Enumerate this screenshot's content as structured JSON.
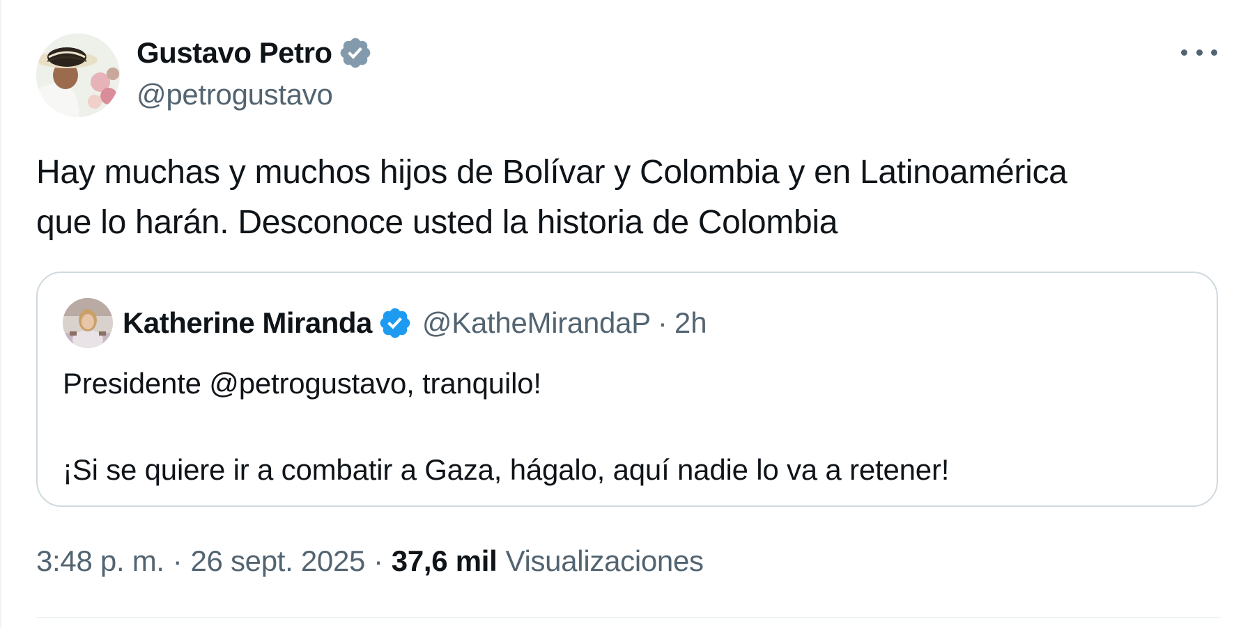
{
  "tweet": {
    "author": {
      "name": "Gustavo Petro",
      "handle": "@petrogustavo",
      "verified_badge": "verified-badge-grey",
      "badge_color": "#829aab"
    },
    "text_lines": [
      "Hay muchas y muchos hijos de Bolívar y Colombia y en Latinoamérica",
      "que lo harán. Desconoce usted la historia de Colombia"
    ],
    "more_icon": "more-options-icon",
    "time": "3:48 p. m.",
    "separator": "·",
    "date": "26 sept. 2025",
    "views_count": "37,6 mil",
    "views_label": "Visualizaciones"
  },
  "quoted_tweet": {
    "author": {
      "name": "Katherine Miranda",
      "handle": "@KatheMirandaP",
      "verified_badge": "verified-badge-blue",
      "badge_color": "#1d9bf0"
    },
    "separator": "·",
    "time_ago": "2h",
    "text_line_1": "Presidente @petrogustavo, tranquilo!",
    "text_line_2": "¡Si se quiere ir a combatir a Gaza, hágalo, aquí nadie lo va a retener!"
  },
  "colors": {
    "primary_text": "#0f1419",
    "secondary_text": "#536471",
    "border": "#cfd9de",
    "divider": "#eff3f4"
  }
}
